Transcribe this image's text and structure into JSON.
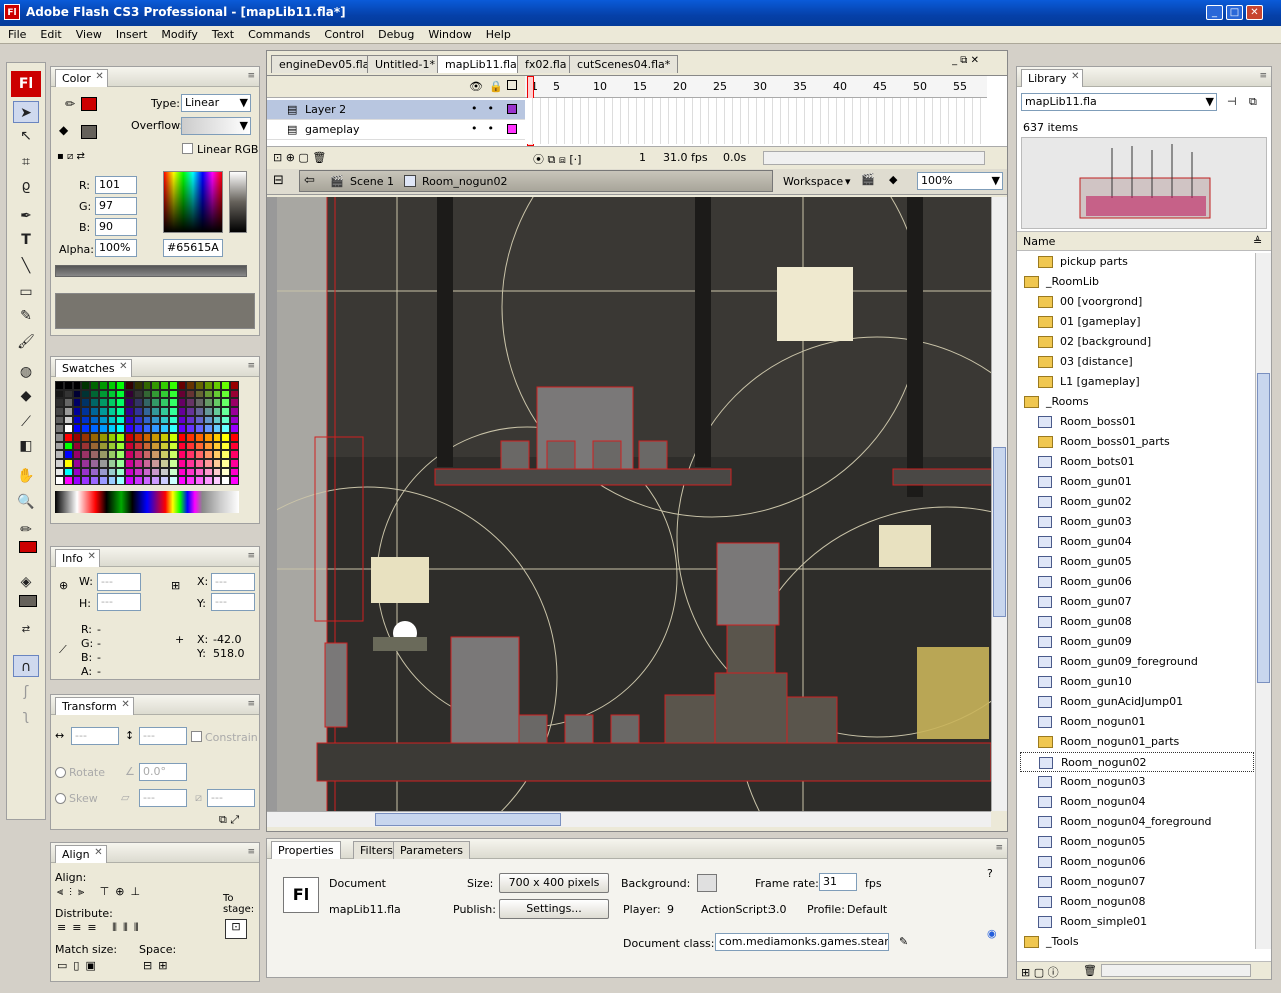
{
  "window": {
    "title": "Adobe Flash CS3 Professional - [mapLib11.fla*]",
    "logo": "Fl"
  },
  "menu": [
    "File",
    "Edit",
    "View",
    "Insert",
    "Modify",
    "Text",
    "Commands",
    "Control",
    "Debug",
    "Window",
    "Help"
  ],
  "tools": {
    "logo": "Fl"
  },
  "color_panel": {
    "tab": "Color",
    "type_label": "Type:",
    "type_value": "Linear",
    "overflow_label": "Overflow:",
    "linear_rgb": "Linear RGB",
    "r_label": "R:",
    "r": "101",
    "g_label": "G:",
    "g": "97",
    "b_label": "B:",
    "b": "90",
    "alpha_label": "Alpha:",
    "alpha": "100%",
    "hex": "#65615A",
    "stroke_color": "#cc0000",
    "fill_color": "#65615A"
  },
  "swatches_panel": {
    "tab": "Swatches"
  },
  "info_panel": {
    "tab": "Info",
    "w_label": "W:",
    "w": "---",
    "h_label": "H:",
    "h": "---",
    "x_label": "X:",
    "x": "---",
    "y_label": "Y:",
    "y": "---",
    "r_label": "R:",
    "r": "-",
    "g_label": "G:",
    "g": "-",
    "b_label": "B:",
    "b": "-",
    "a_label": "A:",
    "a": "-",
    "mx_label": "X:",
    "mx": "-42.0",
    "my_label": "Y:",
    "my": "518.0"
  },
  "transform_panel": {
    "tab": "Transform",
    "w": "---",
    "h": "---",
    "constrain": "Constrain",
    "rotate": "Rotate",
    "rotate_value": "0.0°",
    "skew": "Skew",
    "skew_h": "---",
    "skew_v": "---"
  },
  "align_panel": {
    "tab": "Align",
    "align": "Align:",
    "distribute": "Distribute:",
    "match_size": "Match size:",
    "space": "Space:",
    "to_stage": "To\nstage:"
  },
  "doc_tabs": [
    "engineDev05.fla",
    "Untitled-1*",
    "mapLib11.fla*",
    "fx02.fla",
    "cutScenes04.fla*"
  ],
  "doc_tabs_active": 2,
  "timeline": {
    "layers": [
      {
        "name": "Layer 2",
        "color": "#9933cc"
      },
      {
        "name": "gameplay",
        "color": "#ff33ff"
      }
    ],
    "frame_numbers": [
      "1",
      "5",
      "10",
      "15",
      "20",
      "25",
      "30",
      "35",
      "40",
      "45",
      "50",
      "55"
    ],
    "current_frame": "1",
    "fps": "31.0 fps",
    "time": "0.0s"
  },
  "edit_bar": {
    "scene": "Scene 1",
    "symbol": "Room_nogun02",
    "workspace": "Workspace",
    "zoom": "100%"
  },
  "properties": {
    "tabs": [
      "Properties",
      "Filters",
      "Parameters"
    ],
    "doc_label": "Document",
    "doc_name": "mapLib11.fla",
    "size_label": "Size:",
    "size_value": "700 x 400 pixels",
    "publish_label": "Publish:",
    "settings": "Settings...",
    "background_label": "Background:",
    "frame_rate_label": "Frame rate:",
    "frame_rate": "31",
    "fps_unit": "fps",
    "player_label": "Player:",
    "player": "9",
    "actionscript_label": "ActionScript:",
    "actionscript": "3.0",
    "profile_label": "Profile:",
    "profile": "Default",
    "doc_class_label": "Document class:",
    "doc_class": "com.mediamonks.games.steamtea"
  },
  "library": {
    "tab": "Library",
    "file": "mapLib11.fla",
    "count": "637 items",
    "name_col": "Name",
    "items": [
      {
        "name": "pickup parts",
        "kind": "folder",
        "indent": 1
      },
      {
        "name": "_RoomLib",
        "kind": "folder-open",
        "indent": 0
      },
      {
        "name": "00 [voorgrond]",
        "kind": "folder",
        "indent": 1
      },
      {
        "name": "01 [gameplay]",
        "kind": "folder",
        "indent": 1
      },
      {
        "name": "02 [background]",
        "kind": "folder",
        "indent": 1
      },
      {
        "name": "03 [distance]",
        "kind": "folder",
        "indent": 1
      },
      {
        "name": "L1 [gameplay]",
        "kind": "folder",
        "indent": 1
      },
      {
        "name": "_Rooms",
        "kind": "folder-open",
        "indent": 0
      },
      {
        "name": "Room_boss01",
        "kind": "symbol",
        "indent": 1
      },
      {
        "name": "Room_boss01_parts",
        "kind": "folder",
        "indent": 1
      },
      {
        "name": "Room_bots01",
        "kind": "symbol",
        "indent": 1
      },
      {
        "name": "Room_gun01",
        "kind": "symbol",
        "indent": 1
      },
      {
        "name": "Room_gun02",
        "kind": "symbol",
        "indent": 1
      },
      {
        "name": "Room_gun03",
        "kind": "symbol",
        "indent": 1
      },
      {
        "name": "Room_gun04",
        "kind": "symbol",
        "indent": 1
      },
      {
        "name": "Room_gun05",
        "kind": "symbol",
        "indent": 1
      },
      {
        "name": "Room_gun06",
        "kind": "symbol",
        "indent": 1
      },
      {
        "name": "Room_gun07",
        "kind": "symbol",
        "indent": 1
      },
      {
        "name": "Room_gun08",
        "kind": "symbol",
        "indent": 1
      },
      {
        "name": "Room_gun09",
        "kind": "symbol",
        "indent": 1
      },
      {
        "name": "Room_gun09_foreground",
        "kind": "symbol",
        "indent": 1
      },
      {
        "name": "Room_gun10",
        "kind": "symbol",
        "indent": 1
      },
      {
        "name": "Room_gunAcidJump01",
        "kind": "symbol",
        "indent": 1
      },
      {
        "name": "Room_nogun01",
        "kind": "symbol",
        "indent": 1
      },
      {
        "name": "Room_nogun01_parts",
        "kind": "folder",
        "indent": 1
      },
      {
        "name": "Room_nogun02",
        "kind": "symbol",
        "indent": 1,
        "selected": true
      },
      {
        "name": "Room_nogun03",
        "kind": "symbol",
        "indent": 1
      },
      {
        "name": "Room_nogun04",
        "kind": "symbol",
        "indent": 1
      },
      {
        "name": "Room_nogun04_foreground",
        "kind": "symbol",
        "indent": 1
      },
      {
        "name": "Room_nogun05",
        "kind": "symbol",
        "indent": 1
      },
      {
        "name": "Room_nogun06",
        "kind": "symbol",
        "indent": 1
      },
      {
        "name": "Room_nogun07",
        "kind": "symbol",
        "indent": 1
      },
      {
        "name": "Room_nogun08",
        "kind": "symbol",
        "indent": 1
      },
      {
        "name": "Room_simple01",
        "kind": "symbol",
        "indent": 1
      },
      {
        "name": "_Tools",
        "kind": "folder-open",
        "indent": 0
      }
    ]
  }
}
